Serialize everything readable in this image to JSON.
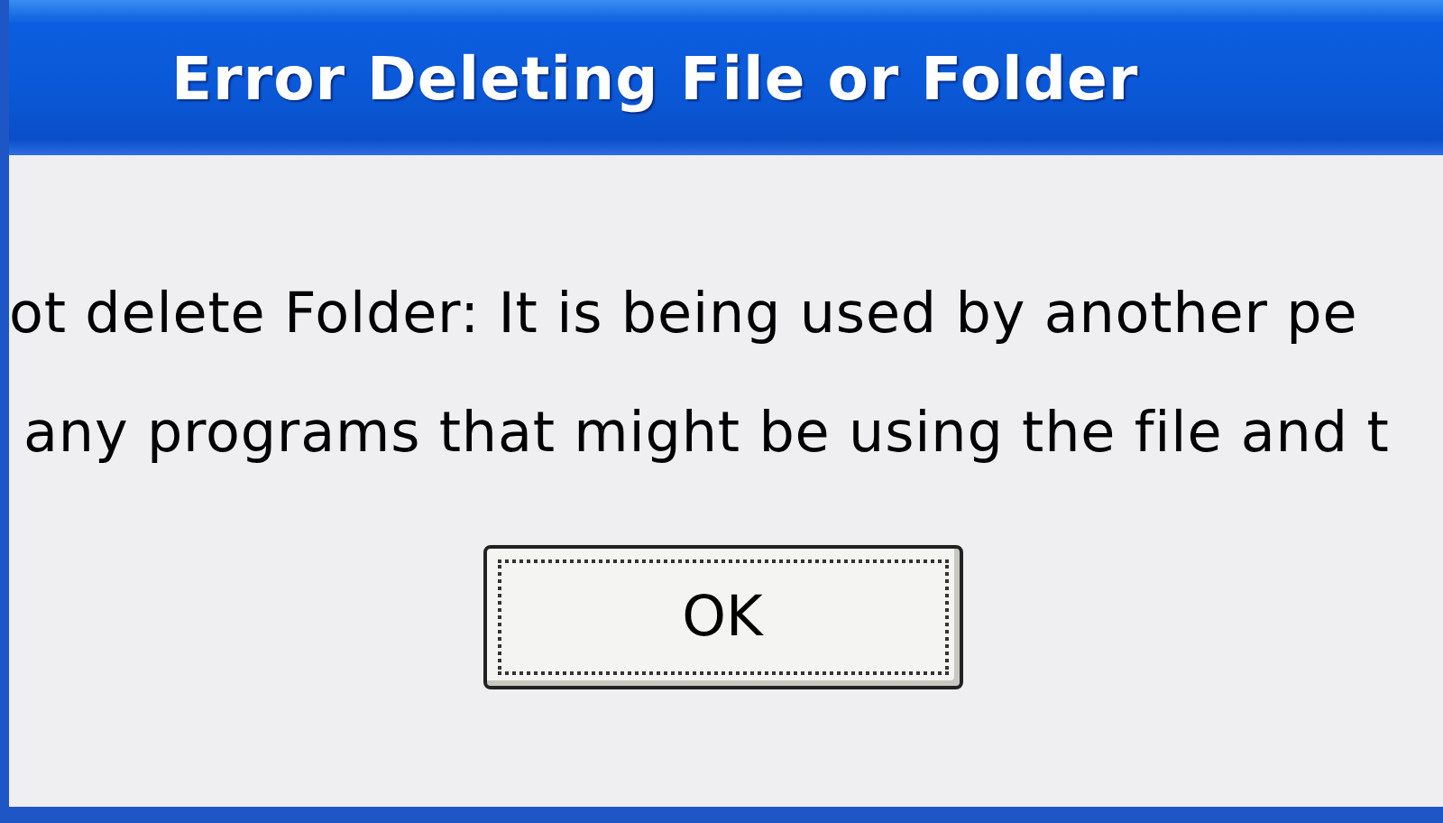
{
  "window": {
    "title": "Error Deleting File or Folder"
  },
  "messages": [
    "ot delete Folder: It is being used by another pe",
    "any programs that might be using the file and t"
  ],
  "buttons": [
    {
      "label": "OK",
      "focused": true
    }
  ]
}
